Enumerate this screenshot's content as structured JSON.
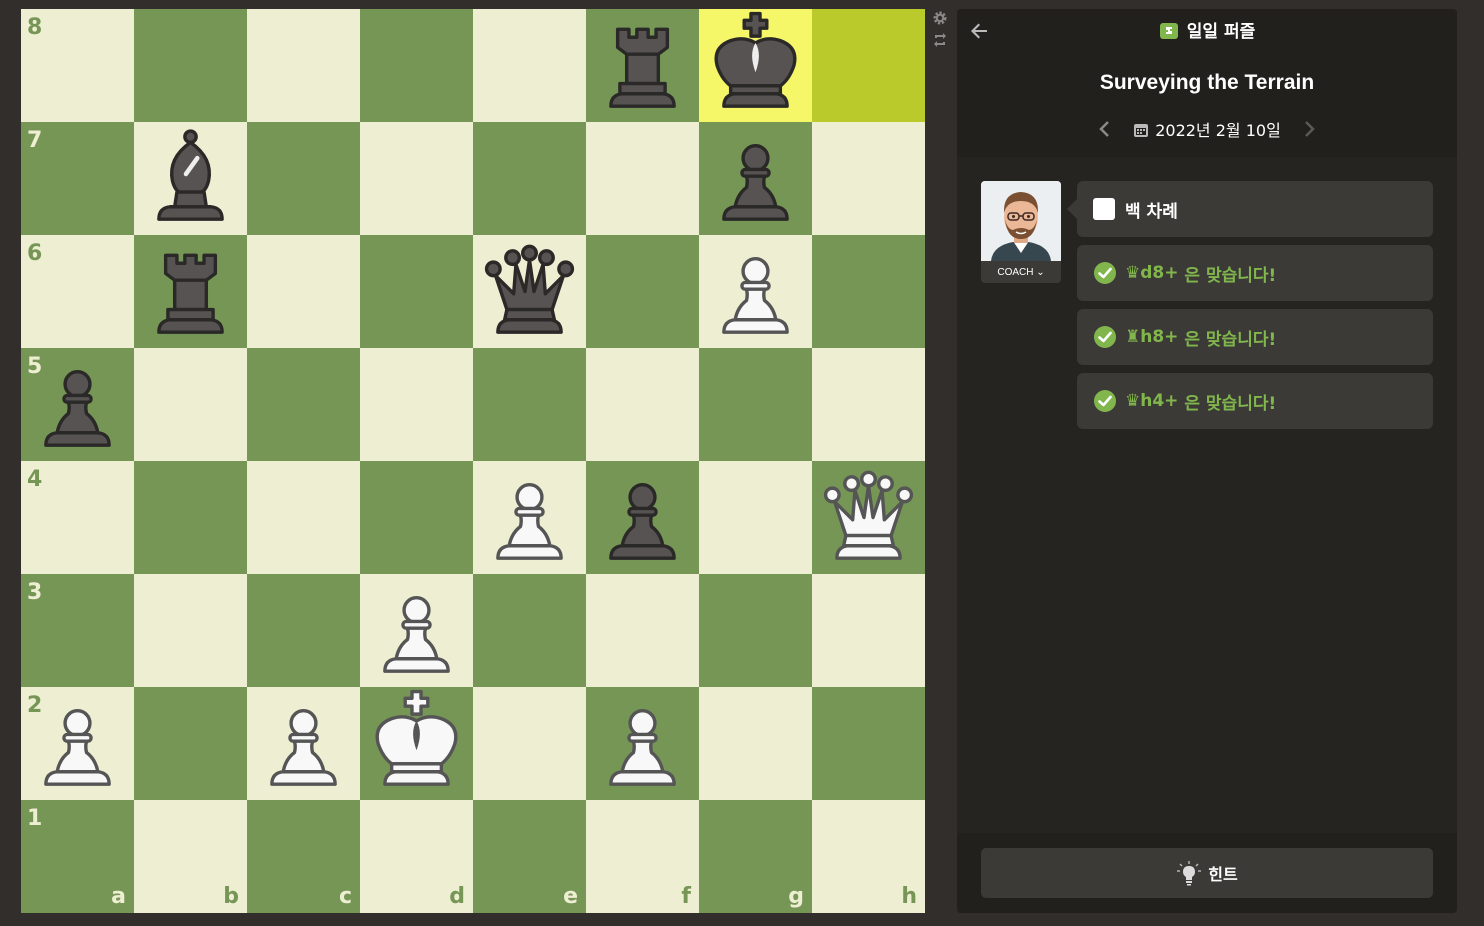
{
  "board": {
    "files": [
      "a",
      "b",
      "c",
      "d",
      "e",
      "f",
      "g",
      "h"
    ],
    "ranks": [
      "8",
      "7",
      "6",
      "5",
      "4",
      "3",
      "2",
      "1"
    ],
    "highlighted": [
      "g8",
      "h8"
    ],
    "pieces": [
      {
        "square": "f8",
        "color": "black",
        "type": "rook"
      },
      {
        "square": "g8",
        "color": "black",
        "type": "king"
      },
      {
        "square": "b7",
        "color": "black",
        "type": "bishop"
      },
      {
        "square": "g7",
        "color": "black",
        "type": "pawn"
      },
      {
        "square": "b6",
        "color": "black",
        "type": "rook"
      },
      {
        "square": "e6",
        "color": "black",
        "type": "queen"
      },
      {
        "square": "g6",
        "color": "white",
        "type": "pawn"
      },
      {
        "square": "a5",
        "color": "black",
        "type": "pawn"
      },
      {
        "square": "e4",
        "color": "white",
        "type": "pawn"
      },
      {
        "square": "f4",
        "color": "black",
        "type": "pawn"
      },
      {
        "square": "h4",
        "color": "white",
        "type": "queen"
      },
      {
        "square": "d3",
        "color": "white",
        "type": "pawn"
      },
      {
        "square": "a2",
        "color": "white",
        "type": "pawn"
      },
      {
        "square": "c2",
        "color": "white",
        "type": "pawn"
      },
      {
        "square": "d2",
        "color": "white",
        "type": "king"
      },
      {
        "square": "f2",
        "color": "white",
        "type": "pawn"
      }
    ]
  },
  "header": {
    "puzzle_type": "일일 퍼즐",
    "title": "Surveying the Terrain",
    "date": "2022년 2월 10일"
  },
  "coach": {
    "label": "COACH"
  },
  "messages": {
    "turn": "백 차례",
    "moves": [
      {
        "piece": "♛",
        "move": "d8+",
        "text": "은 맞습니다!"
      },
      {
        "piece": "♜",
        "move": "h8+",
        "text": "은 맞습니다!"
      },
      {
        "piece": "♛",
        "move": "h4+",
        "text": "은 맞습니다!"
      }
    ]
  },
  "footer": {
    "hint_label": "힌트"
  },
  "colors": {
    "light_square": "#eeeed2",
    "dark_square": "#769656",
    "highlight_light": "#f6f669",
    "highlight_dark": "#baca2b",
    "accent_green": "#81b64c"
  }
}
